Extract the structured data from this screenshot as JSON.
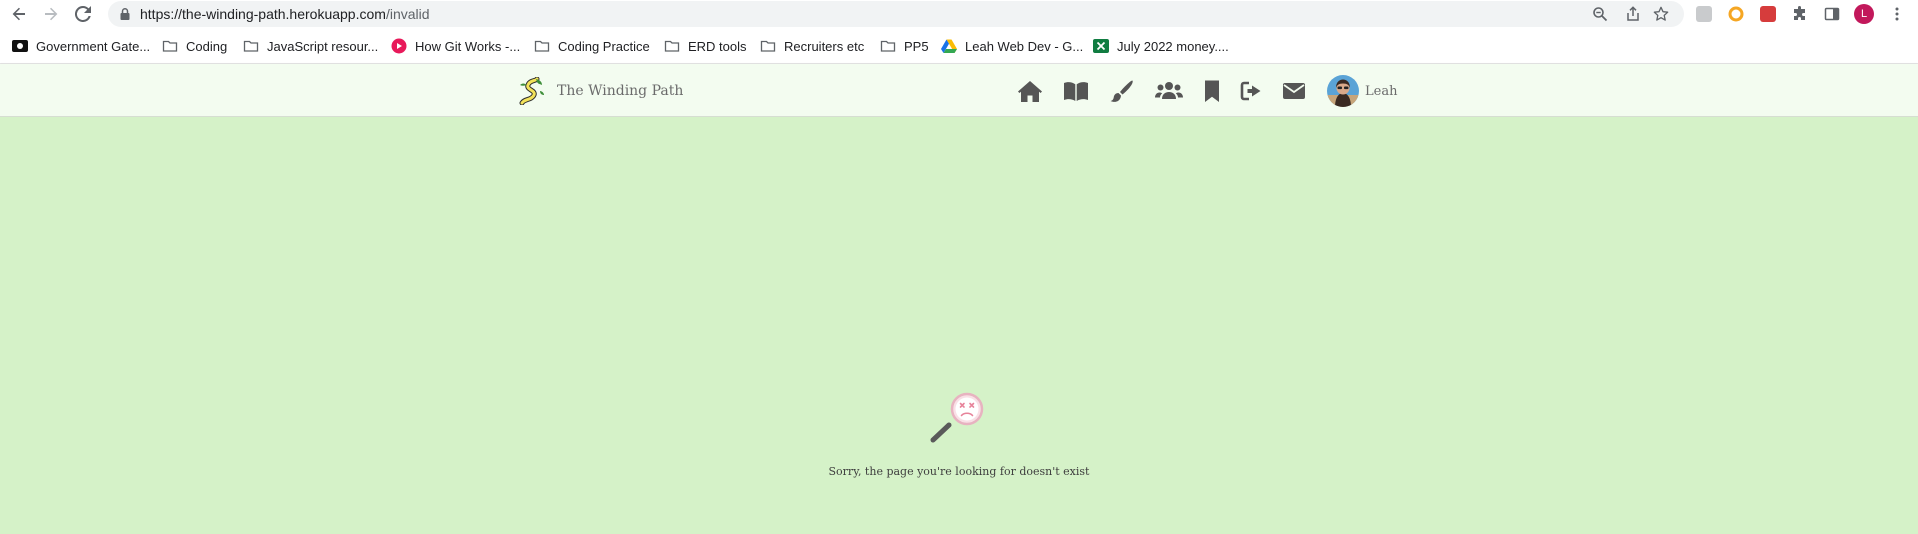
{
  "browser": {
    "url_host": "https://the-winding-path.herokuapp.com",
    "url_path": "/invalid",
    "profile_initial": "L",
    "icons": {
      "back": "arrow-left-icon",
      "forward": "arrow-right-icon",
      "reload": "reload-icon",
      "lock": "lock-icon",
      "zoom": "zoom-icon",
      "share": "share-icon",
      "star": "star-icon",
      "extensions": "puzzle-icon",
      "side_panel": "side-panel-icon",
      "menu": "kebab-menu-icon"
    }
  },
  "bookmarks": [
    {
      "label": "Government Gate...",
      "icon": "gov-favicon"
    },
    {
      "label": "Coding",
      "icon": "folder-icon"
    },
    {
      "label": "JavaScript resour...",
      "icon": "folder-icon"
    },
    {
      "label": "How Git Works -...",
      "icon": "red-circle-favicon"
    },
    {
      "label": "Coding Practice",
      "icon": "folder-icon"
    },
    {
      "label": "ERD tools",
      "icon": "folder-icon"
    },
    {
      "label": "Recruiters etc",
      "icon": "folder-icon"
    },
    {
      "label": "PP5",
      "icon": "folder-icon"
    },
    {
      "label": "Leah Web Dev - G...",
      "icon": "google-drive-favicon"
    },
    {
      "label": "July 2022 money....",
      "icon": "excel-favicon"
    }
  ],
  "site": {
    "brand_name": "The Winding Path",
    "user_name": "Leah",
    "nav_icons": [
      "home-icon",
      "book-icon",
      "paintbrush-icon",
      "users-icon",
      "bookmark-icon",
      "sign-out-icon",
      "envelope-icon"
    ],
    "colors": {
      "page_bg": "#d5f2c8",
      "navbar_bg": "#f3fcf0",
      "icon": "#555555",
      "accent_pink": "#e7839a"
    }
  },
  "error": {
    "message": "Sorry, the page you're looking for doesn't exist",
    "icon": "magnifier-sad-icon"
  }
}
